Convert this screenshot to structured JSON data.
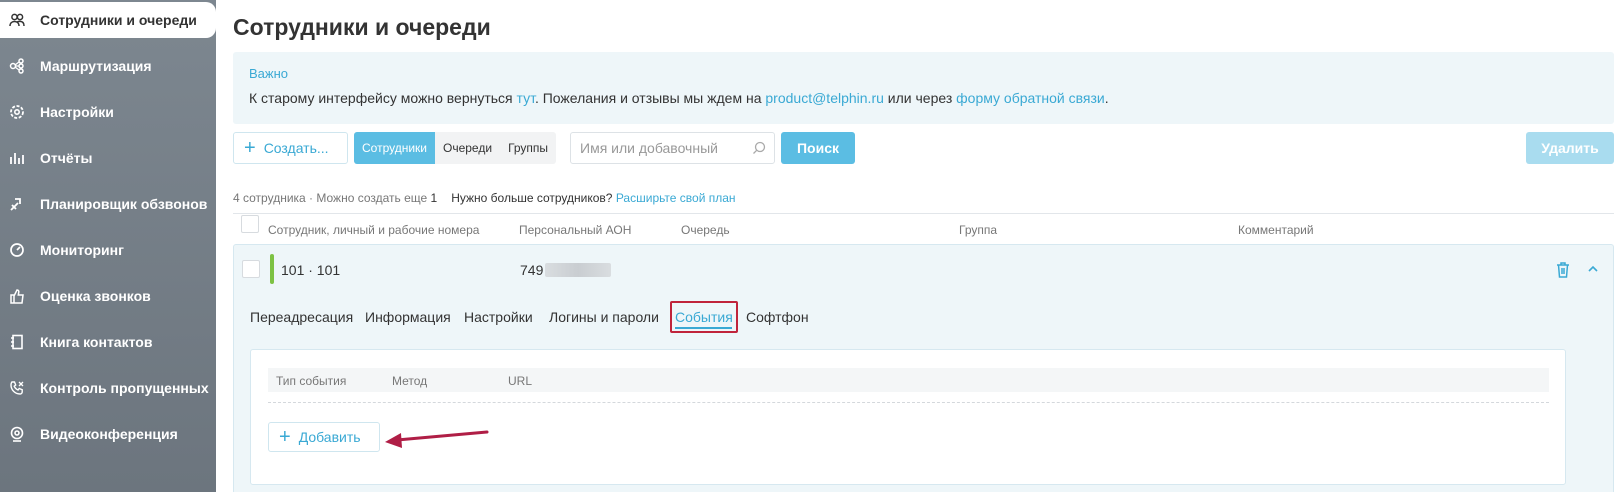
{
  "sidebar": {
    "items": [
      {
        "label": "Сотрудники и очереди",
        "icon": "people-icon",
        "active": true
      },
      {
        "label": "Маршрутизация",
        "icon": "routing-icon"
      },
      {
        "label": "Настройки",
        "icon": "gear-icon"
      },
      {
        "label": "Отчёты",
        "icon": "bar-chart-icon"
      },
      {
        "label": "Планировщик обзвонов",
        "icon": "dialer-icon"
      },
      {
        "label": "Мониторинг",
        "icon": "gauge-icon"
      },
      {
        "label": "Оценка звонков",
        "icon": "thumbs-up-icon"
      },
      {
        "label": "Книга контактов",
        "icon": "contacts-book-icon"
      },
      {
        "label": "Контроль пропущенных",
        "icon": "missed-call-icon"
      },
      {
        "label": "Видеоконференция",
        "icon": "webcam-icon"
      }
    ]
  },
  "page": {
    "title": "Сотрудники и очереди"
  },
  "notice": {
    "title": "Важно",
    "text_1": "К старому интерфейсу можно вернуться ",
    "link_here": "тут",
    "text_2": ". Пожелания и отзывы мы ждем на ",
    "email": "product@telphin.ru",
    "text_3": " или через ",
    "link_form": "форму обратной связи",
    "text_4": "."
  },
  "toolbar": {
    "create_label": "Создать...",
    "segments": [
      "Сотрудники",
      "Очереди",
      "Группы"
    ],
    "search_placeholder": "Имя или добавочный",
    "search_label": "Поиск",
    "delete_label": "Удалить"
  },
  "summary": {
    "count": "4 сотрудника · Можно создать еще ",
    "remaining": "1",
    "need_more": "Нужно больше сотрудников?",
    "upgrade": "Расширьте свой план"
  },
  "table": {
    "columns": [
      "Сотрудник, личный и рабочие номера",
      "Персональный АОН",
      "Очередь",
      "Группа",
      "Комментарий"
    ]
  },
  "user": {
    "name": "101 · 101",
    "aon_prefix": "749"
  },
  "tabs": [
    "Переадресация",
    "Информация",
    "Настройки",
    "Логины и пароли",
    "События",
    "Софтфон"
  ],
  "events": {
    "columns": [
      "Тип события",
      "Метод",
      "URL"
    ],
    "add_label": "Добавить"
  },
  "colors": {
    "accent": "#3aa9d4",
    "button": "#5bbde3",
    "highlight": "#c0243b",
    "status": "#7dc243"
  }
}
